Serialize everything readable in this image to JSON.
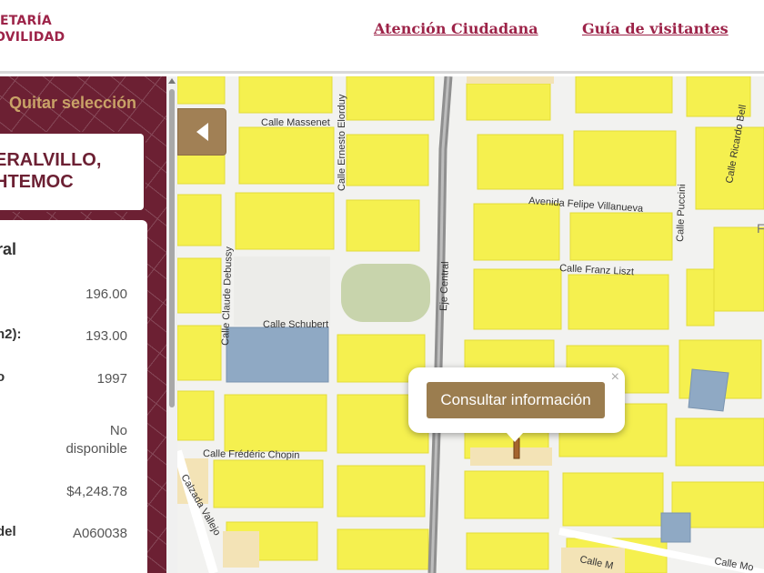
{
  "header": {
    "logo_line1": "ETARÍA",
    "logo_line2": "OVILIDAD",
    "nav": [
      "Atención Ciudadana",
      "Guía de visitantes"
    ]
  },
  "sidebar": {
    "clear_selection": "Quitar selección",
    "colonia_line1": "ERALVILLO,",
    "colonia_line2": "HTEMOC",
    "info_title": "ral",
    "rows": [
      {
        "label": "",
        "value": "196.00"
      },
      {
        "label": "n2):",
        "value": "193.00"
      },
      {
        "label": "o",
        "value": "1997"
      },
      {
        "label": "",
        "value_line1": "No",
        "value_line2": "disponible"
      },
      {
        "label": "",
        "value": "$4,248.78"
      },
      {
        "label": "del",
        "value": "A060038"
      }
    ]
  },
  "map": {
    "streets": {
      "massenet": "Calle Massenet",
      "ernesto_elorduy": "Calle Ernesto Elorduy",
      "felipe_villanueva": "Avenida Felipe Villanueva",
      "puccini": "Calle Puccini",
      "ricardo_bell": "Calle Ricardo Bell",
      "franz_liszt": "Calle Franz Liszt",
      "claude_debussy": "Calle Claude Debussy",
      "schubert": "Calle Schubert",
      "eje_central": "Eje Central",
      "chopin": "Calle Frédéric Chopin",
      "calzada_vallejo": "Calzada Vallejo",
      "calle_m": "Calle M",
      "calle_mo": "Calle Mo",
      "edge_f": "F"
    },
    "popup": {
      "button": "Consultar información",
      "close": "×"
    }
  },
  "colors": {
    "brand": "#9d2449",
    "sidebar": "#6c2033",
    "accent": "#9b7d4f",
    "block": "#f5f04f",
    "park": "#c8d4ac",
    "water": "#8fa9c4"
  },
  "icons": {
    "collapse": "chevron-left-icon",
    "close": "close-icon"
  }
}
